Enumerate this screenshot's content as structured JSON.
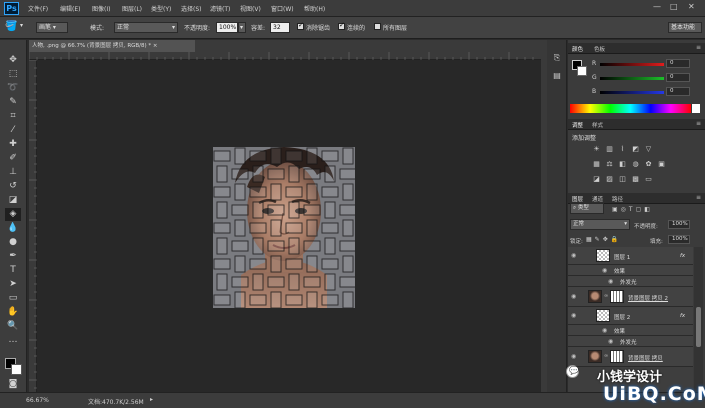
{
  "app": {
    "logo": "Ps"
  },
  "menus": [
    "文件(F)",
    "编辑(E)",
    "图像(I)",
    "图层(L)",
    "类型(Y)",
    "选择(S)",
    "滤镜(T)",
    "视图(V)",
    "窗口(W)",
    "帮助(H)"
  ],
  "window_controls": [
    "—",
    "□",
    "✕"
  ],
  "options": {
    "tool_preset": "画笔",
    "mode_label": "模式:",
    "mode_value": "正常",
    "opacity_label": "不透明度:",
    "opacity_value": "100%",
    "tolerance_label": "容差:",
    "tolerance_value": "32",
    "antialias_label": "消除锯齿",
    "contiguous_label": "连续的",
    "all_layers_label": "所有图层",
    "workspace": "基本功能"
  },
  "document_tab": "人物, .png @ 66.7% (背景图层 拷贝, RGB/8) *  ×",
  "tools": [
    "move",
    "marquee",
    "lasso",
    "quick-select",
    "crop",
    "eyedropper",
    "healing",
    "brush",
    "clone",
    "history-brush",
    "eraser",
    "paint-bucket",
    "blur",
    "dodge",
    "pen",
    "type",
    "path-select",
    "shape",
    "hand",
    "zoom",
    "more"
  ],
  "status": {
    "zoom": "66.67%",
    "doc": "文档:470.7K/2.56M"
  },
  "color_panel": {
    "tabs": [
      "颜色",
      "色板"
    ],
    "channels": [
      {
        "label": "R",
        "value": "0",
        "color": "#e01c1c"
      },
      {
        "label": "G",
        "value": "0",
        "color": "#1cbf2a"
      },
      {
        "label": "B",
        "value": "0",
        "color": "#2438e6"
      }
    ]
  },
  "adjust_panel": {
    "tabs": [
      "调整",
      "样式"
    ],
    "title": "添加调整"
  },
  "layers_panel": {
    "tabs": [
      "图层",
      "通道",
      "路径"
    ],
    "filter": "类型",
    "blend_mode": "正常",
    "opacity_label": "不透明度:",
    "opacity_value": "100%",
    "lock_label": "锁定:",
    "fill_label": "填充:",
    "fill_value": "100%",
    "layers": [
      {
        "name": "图层 1",
        "fx": "fx",
        "kind": "checker"
      },
      {
        "name": "效果",
        "kind": "sub"
      },
      {
        "name": "外发光",
        "kind": "sub"
      },
      {
        "name": "背景图层 拷贝 2",
        "kind": "photo"
      },
      {
        "name": "图层 2",
        "fx": "fx",
        "kind": "checker"
      },
      {
        "name": "效果",
        "kind": "sub"
      },
      {
        "name": "外发光",
        "kind": "sub"
      },
      {
        "name": "背景图层 拷贝",
        "kind": "photo"
      }
    ]
  },
  "watermark": {
    "brand": "小钱学设计",
    "site": "UiBQ.CoM"
  }
}
